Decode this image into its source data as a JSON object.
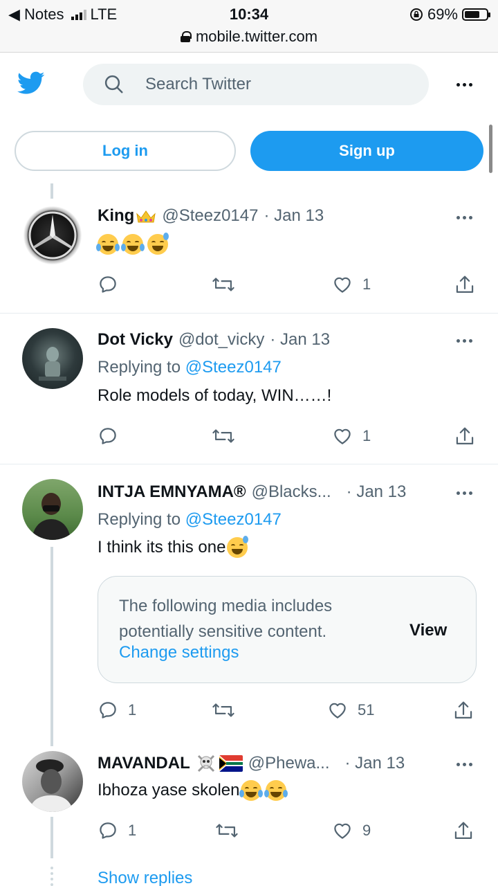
{
  "status": {
    "back_app": "◀ Notes",
    "carrier": "LTE",
    "time": "10:34",
    "battery": "69%",
    "battery_fraction": 0.69,
    "url": "mobile.twitter.com"
  },
  "nav": {
    "search_placeholder": "Search Twitter"
  },
  "auth": {
    "login": "Log in",
    "signup": "Sign up"
  },
  "tweets": [
    {
      "name": "King",
      "handle": "@Steez0147",
      "date": "· Jan 13",
      "reply_count": "",
      "retweet_count": "",
      "like_count": "1"
    },
    {
      "name": "Dot Vicky",
      "handle": "@dot_vicky",
      "date": "· Jan 13",
      "replying_prefix": "Replying to",
      "replying_to": "@Steez0147",
      "text": "Role models of today, WIN……!",
      "like_count": "1"
    },
    {
      "name": "INTJA EMNYAMA®",
      "handle": "@Blacks...",
      "date": "· Jan 13",
      "replying_prefix": "Replying to",
      "replying_to": "@Steez0147",
      "text": "I think its this one",
      "sensitive_text": "The following media includes potentially sensitive content.",
      "sensitive_link": "Change settings",
      "sensitive_view": "View",
      "reply_count": "1",
      "like_count": "51"
    },
    {
      "name": "MAVANDAL",
      "handle": "@Phewa...",
      "date": "· Jan 13",
      "text": "Ibhoza yase skolen",
      "reply_count": "1",
      "like_count": "9"
    }
  ],
  "show_replies": "Show replies",
  "colors": {
    "accent": "#1d9bf0",
    "muted": "#536471",
    "divider": "#e6ecf0"
  },
  "icons": [
    "twitter-bird-icon",
    "search-icon",
    "more-icon",
    "reply-icon",
    "retweet-icon",
    "like-icon",
    "share-icon",
    "crown-icon",
    "skull-icon",
    "south-africa-flag-icon"
  ]
}
